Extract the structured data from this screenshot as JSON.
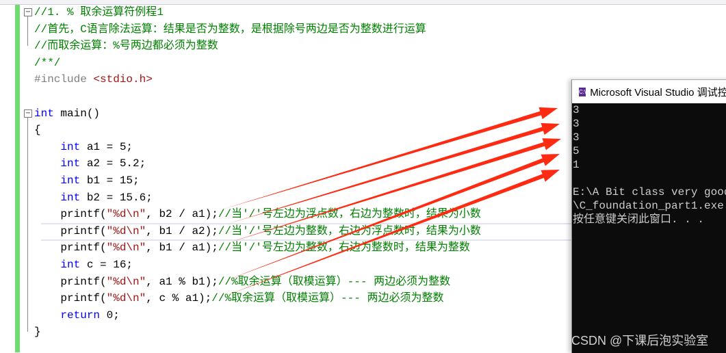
{
  "colors": {
    "comment": "#008000",
    "keyword": "#0000ff",
    "string": "#a31515",
    "preprocessor": "#808080",
    "arrow": "#ff2a12",
    "console_bg": "#0c0c0c"
  },
  "editor": {
    "current_line": 13,
    "lines": [
      [
        {
          "t": "comment",
          "s": "//1. % 取余运算符例程1"
        }
      ],
      [
        {
          "t": "comment",
          "s": "//首先，C语言除法运算：结果是否为整数，是根据除号两边是否为整数进行运算"
        }
      ],
      [
        {
          "t": "comment",
          "s": "//而取余运算：%号两边都必须为整数"
        }
      ],
      [
        {
          "t": "comment",
          "s": "/**/"
        }
      ],
      [
        {
          "t": "pp",
          "s": "#include "
        },
        {
          "t": "inc",
          "s": "<stdio.h>"
        }
      ],
      [],
      [
        {
          "t": "kw",
          "s": "int"
        },
        {
          "t": "",
          "s": " main()"
        }
      ],
      [
        {
          "t": "",
          "s": "{"
        }
      ],
      [
        {
          "t": "",
          "s": "    "
        },
        {
          "t": "kw",
          "s": "int"
        },
        {
          "t": "",
          "s": " a1 = 5;"
        }
      ],
      [
        {
          "t": "",
          "s": "    "
        },
        {
          "t": "kw",
          "s": "int"
        },
        {
          "t": "",
          "s": " a2 = 5.2;"
        }
      ],
      [
        {
          "t": "",
          "s": "    "
        },
        {
          "t": "kw",
          "s": "int"
        },
        {
          "t": "",
          "s": " b1 = 15;"
        }
      ],
      [
        {
          "t": "",
          "s": "    "
        },
        {
          "t": "kw",
          "s": "int"
        },
        {
          "t": "",
          "s": " b2 = 15.6;"
        }
      ],
      [
        {
          "t": "",
          "s": "    printf("
        },
        {
          "t": "str",
          "s": "\"%d\\n\""
        },
        {
          "t": "",
          "s": ", b2 / a1);"
        },
        {
          "t": "comment",
          "s": "//当'/'号左边为浮点数，右边为整数时，结果为小数"
        }
      ],
      [
        {
          "t": "",
          "s": "    printf("
        },
        {
          "t": "str",
          "s": "\"%d\\n\""
        },
        {
          "t": "",
          "s": ", b1 / a2);"
        },
        {
          "t": "comment",
          "s": "//当'/'号左边为整数，右边为浮点数时，结果为小数"
        }
      ],
      [
        {
          "t": "",
          "s": "    printf("
        },
        {
          "t": "str",
          "s": "\"%d\\n\""
        },
        {
          "t": "",
          "s": ", b1 / a1);"
        },
        {
          "t": "comment",
          "s": "//当'/'号左边为整数，右边为整数时，结果为整数"
        }
      ],
      [
        {
          "t": "",
          "s": "    "
        },
        {
          "t": "kw",
          "s": "int"
        },
        {
          "t": "",
          "s": " c = 16;"
        }
      ],
      [
        {
          "t": "",
          "s": "    printf("
        },
        {
          "t": "str",
          "s": "\"%d\\n\""
        },
        {
          "t": "",
          "s": ", a1 % b1);"
        },
        {
          "t": "comment",
          "s": "//%取余运算（取模运算）--- 两边必须为整数"
        }
      ],
      [
        {
          "t": "",
          "s": "    printf("
        },
        {
          "t": "str",
          "s": "\"%d\\n\""
        },
        {
          "t": "",
          "s": ", c % a1);"
        },
        {
          "t": "comment",
          "s": "//%取余运算（取模运算）--- 两边必须为整数"
        }
      ],
      [
        {
          "t": "",
          "s": "    "
        },
        {
          "t": "kw",
          "s": "return"
        },
        {
          "t": "",
          "s": " 0;"
        }
      ],
      [
        {
          "t": "",
          "s": "}"
        }
      ]
    ]
  },
  "console": {
    "title": "Microsoft Visual Studio 调试控制台",
    "icon": "visual-studio-icon",
    "output": [
      "3",
      "3",
      "3",
      "5",
      "1",
      "",
      "E:\\A Bit class very good",
      "\\C_foundation_part1.exe",
      "按任意键关闭此窗口. . ."
    ]
  },
  "watermark": "CSDN @下课后泡实验室"
}
